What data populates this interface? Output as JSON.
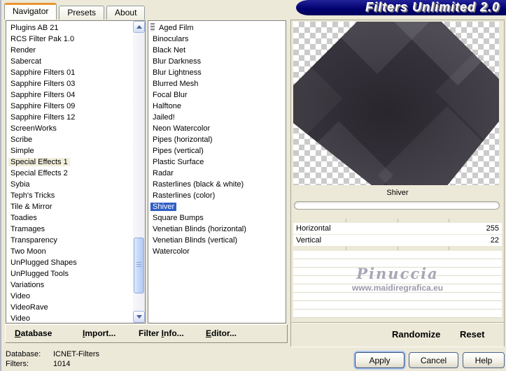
{
  "window": {
    "banner_title": "Filters Unlimited 2.0",
    "tabs": [
      {
        "label": "Navigator",
        "active": true
      },
      {
        "label": "Presets",
        "active": false
      },
      {
        "label": "About",
        "active": false
      }
    ]
  },
  "category_list": {
    "selected": "Special Effects 1",
    "items": [
      "Plugins AB 21",
      "RCS Filter Pak 1.0",
      "Render",
      "Sabercat",
      "Sapphire Filters 01",
      "Sapphire Filters 03",
      "Sapphire Filters 04",
      "Sapphire Filters 09",
      "Sapphire Filters 12",
      "ScreenWorks",
      "Scribe",
      "Simple",
      "Special Effects 1",
      "Special Effects 2",
      "Sybia",
      "Teph's Tricks",
      "Tile & Mirror",
      "Toadies",
      "Tramages",
      "Transparency",
      "Two Moon",
      "UnPlugged Shapes",
      "UnPlugged Tools",
      "Variations",
      "Video",
      "VideoRave",
      "Video"
    ]
  },
  "filter_list": {
    "selected": "Shiver",
    "items": [
      "Aged Film",
      "Binoculars",
      "Black Net",
      "Blur Darkness",
      "Blur Lightness",
      "Blurred Mesh",
      "Focal Blur",
      "Halftone",
      "Jailed!",
      "Neon Watercolor",
      "Pipes (horizontal)",
      "Pipes (vertical)",
      "Plastic Surface",
      "Radar",
      "Rasterlines (black & white)",
      "Rasterlines (color)",
      "Shiver",
      "Square Bumps",
      "Venetian Blinds (horizontal)",
      "Venetian Blinds (vertical)",
      "Watercolor"
    ]
  },
  "preview": {
    "caption": "Shiver"
  },
  "controls": {
    "sliders": [
      {
        "label": "Horizontal",
        "value": "255"
      },
      {
        "label": "Vertical",
        "value": "22"
      }
    ],
    "empty_rows": 8,
    "randomize_label": "Randomize",
    "reset_label": "Reset"
  },
  "watermark": {
    "name": "Pinuccia",
    "url": "www.maidiregrafica.eu"
  },
  "menu_bar": {
    "items": [
      {
        "pre": "",
        "mn": "D",
        "post": "atabase"
      },
      {
        "pre": "",
        "mn": "I",
        "post": "mport..."
      },
      {
        "pre": "Filter ",
        "mn": "I",
        "post": "nfo..."
      },
      {
        "pre": "",
        "mn": "E",
        "post": "ditor..."
      }
    ]
  },
  "status": {
    "database_label": "Database:",
    "database_value": "ICNET-Filters",
    "filters_label": "Filters:",
    "filters_value": "1014"
  },
  "action_buttons": [
    {
      "label": "Apply"
    },
    {
      "label": "Cancel"
    },
    {
      "label": "Help"
    }
  ],
  "colors": {
    "window_bg": "#ECE9D8",
    "banner_bg": "#020270",
    "selection_active": "#2F5FC5",
    "selection_inactive": "#F2EFDC",
    "tab_accent": "#E9952E",
    "checker_gray": "#CBCBCB",
    "shape_base": "#3A3640"
  }
}
